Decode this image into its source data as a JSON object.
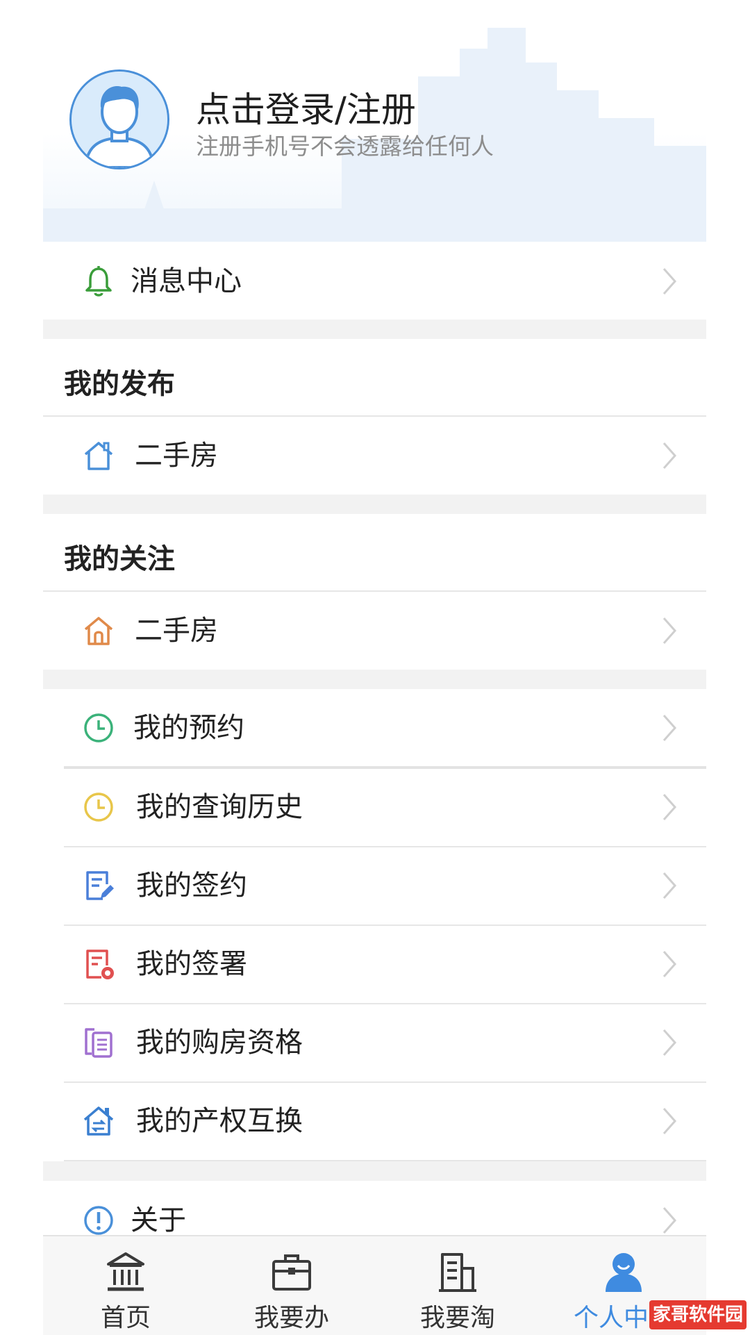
{
  "header": {
    "login_title": "点击登录/注册",
    "login_subtitle": "注册手机号不会透露给任何人"
  },
  "message_center": {
    "label": "消息中心",
    "icon": "bell-icon"
  },
  "my_posts": {
    "title": "我的发布",
    "items": [
      {
        "label": "二手房",
        "icon": "house-outline-icon"
      }
    ]
  },
  "my_follows": {
    "title": "我的关注",
    "items": [
      {
        "label": "二手房",
        "icon": "house-icon"
      }
    ]
  },
  "services": [
    {
      "label": "我的预约",
      "icon": "clock-green-icon"
    },
    {
      "label": "我的查询历史",
      "icon": "clock-yellow-icon"
    },
    {
      "label": "我的签约",
      "icon": "document-pen-icon"
    },
    {
      "label": "我的签署",
      "icon": "document-seal-icon"
    },
    {
      "label": "我的购房资格",
      "icon": "documents-icon"
    },
    {
      "label": "我的产权互换",
      "icon": "house-exchange-icon"
    }
  ],
  "about": {
    "label": "关于",
    "icon": "info-icon"
  },
  "bottom_nav": [
    {
      "label": "首页",
      "icon": "bank-building-icon"
    },
    {
      "label": "我要办",
      "icon": "briefcase-icon"
    },
    {
      "label": "我要淘",
      "icon": "building-icon"
    },
    {
      "label": "个人中心",
      "icon": "person-icon",
      "active": true
    }
  ],
  "watermark": "家哥软件园",
  "colors": {
    "accent": "#3f8be0",
    "separator": "#f2f2f2",
    "bell": "#3a9d3a",
    "house_posted": "#4a90d9",
    "house_followed": "#e08a4a",
    "clock_green": "#3bb27a",
    "clock_yellow": "#e8c64a",
    "sign": "#4a7fd9",
    "seal": "#e05050",
    "qualification": "#a070d0",
    "exchange": "#3a7fd0"
  }
}
